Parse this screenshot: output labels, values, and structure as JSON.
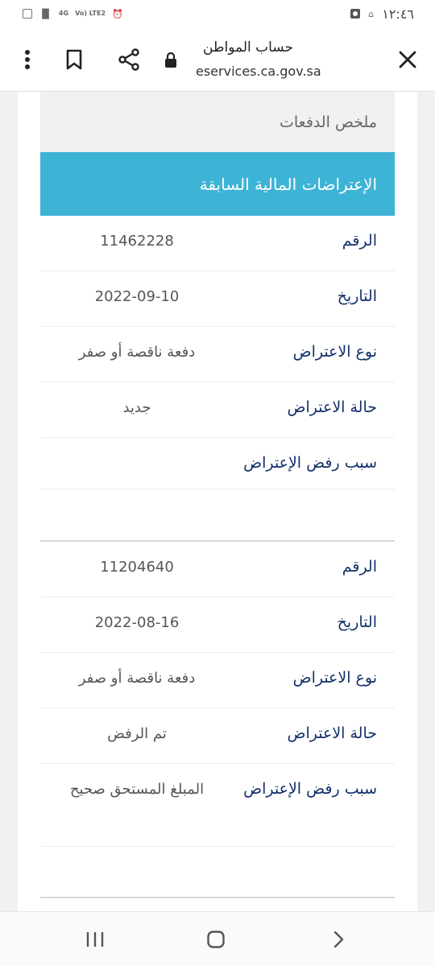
{
  "status_bar": {
    "time": "١٢:٤٦",
    "network": "4G",
    "volte": "Vo) LTE2"
  },
  "browser": {
    "page_title": "حساب المواطن",
    "domain": "eservices.ca.gov.sa"
  },
  "page": {
    "summary_title": "ملخص الدفعات",
    "section_title": "الإعتراضات المالية السابقة"
  },
  "labels": {
    "number": "الرقم",
    "date": "التاريخ",
    "type": "نوع الاعتراض",
    "status": "حالة الاعتراض",
    "reason": "سبب رفض الإعتراض"
  },
  "records": [
    {
      "number": "11462228",
      "date": "2022-09-10",
      "type": "دفعة ناقصة أو صفر",
      "status": "جديد",
      "reason": ""
    },
    {
      "number": "11204640",
      "date": "2022-08-16",
      "type": "دفعة ناقصة أو صفر",
      "status": "تم الرفض",
      "reason": "المبلغ المستحق صحيح"
    }
  ]
}
